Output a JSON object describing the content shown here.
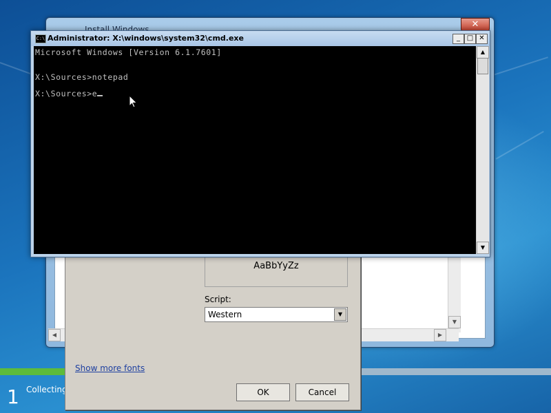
{
  "install_window": {
    "title": "Install Windows",
    "close_label": "✕"
  },
  "cmd": {
    "title": "Administrator: X:\\windows\\system32\\cmd.exe",
    "icon_text": "C:\\",
    "minimize": "_",
    "maximize": "□",
    "close": "✕",
    "lines": [
      "Microsoft Windows [Version 6.1.7601]",
      "X:\\Sources>notepad",
      "X:\\Sources>e"
    ]
  },
  "font_dialog": {
    "sample_text": "AaBbYyZz",
    "script_label": "Script:",
    "script_value": "Western",
    "show_more_fonts": "Show more fonts",
    "ok_label": "OK",
    "cancel_label": "Cancel"
  },
  "status": {
    "step_number": "1",
    "step_label": "Collecting",
    "progress_fraction": 0.12
  },
  "icons": {
    "dropdown_arrow": "▼",
    "scroll_up": "▲",
    "scroll_down": "▼",
    "scroll_left": "◀",
    "scroll_right": "▶"
  }
}
